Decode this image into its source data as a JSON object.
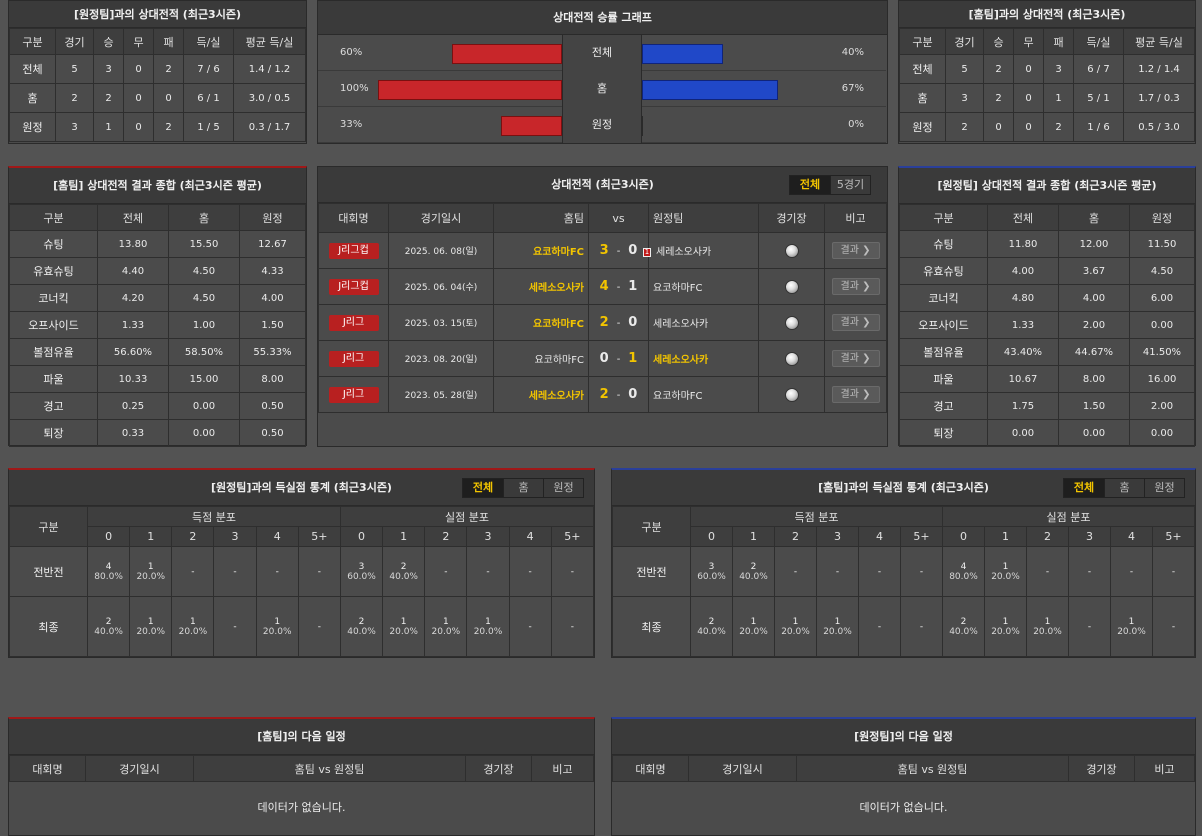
{
  "h2h_away": {
    "title": "[원정팀]과의 상대전적 (최근3시즌)",
    "headers": [
      "구분",
      "경기",
      "승",
      "무",
      "패",
      "득/실",
      "평균 득/실"
    ],
    "rows": [
      [
        "전체",
        "5",
        "3",
        "0",
        "2",
        "7 / 6",
        "1.4 / 1.2"
      ],
      [
        "홈",
        "2",
        "2",
        "0",
        "0",
        "6 / 1",
        "3.0 / 0.5"
      ],
      [
        "원정",
        "3",
        "1",
        "0",
        "2",
        "1 / 5",
        "0.3 / 1.7"
      ]
    ]
  },
  "graph": {
    "title": "상대전적 승률 그래프",
    "rows": [
      {
        "label": "전체",
        "left": "60%",
        "right": "40%",
        "left_val": 0.6,
        "right_val": 0.4
      },
      {
        "label": "홈",
        "left": "100%",
        "right": "67%",
        "left_val": 1.0,
        "right_val": 0.67
      },
      {
        "label": "원정",
        "left": "33%",
        "right": "0%",
        "left_val": 0.33,
        "right_val": 0.0
      }
    ]
  },
  "h2h_home": {
    "title": "[홈팀]과의 상대전적 (최근3시즌)",
    "headers": [
      "구분",
      "경기",
      "승",
      "무",
      "패",
      "득/실",
      "평균 득/실"
    ],
    "rows": [
      [
        "전체",
        "5",
        "2",
        "0",
        "3",
        "6 / 7",
        "1.2 / 1.4"
      ],
      [
        "홈",
        "3",
        "2",
        "0",
        "1",
        "5 / 1",
        "1.7 / 0.3"
      ],
      [
        "원정",
        "2",
        "0",
        "0",
        "2",
        "1 / 6",
        "0.5 / 3.0"
      ]
    ]
  },
  "summary_home": {
    "title": "[홈팀] 상대전적 결과 종합 (최근3시즌 평균)",
    "headers": [
      "구분",
      "전체",
      "홈",
      "원정"
    ],
    "rows": [
      [
        "슈팅",
        "13.80",
        "15.50",
        "12.67"
      ],
      [
        "유효슈팅",
        "4.40",
        "4.50",
        "4.33"
      ],
      [
        "코너킥",
        "4.20",
        "4.50",
        "4.00"
      ],
      [
        "오프사이드",
        "1.33",
        "1.00",
        "1.50"
      ],
      [
        "볼점유율",
        "56.60%",
        "58.50%",
        "55.33%"
      ],
      [
        "파울",
        "10.33",
        "15.00",
        "8.00"
      ],
      [
        "경고",
        "0.25",
        "0.00",
        "0.50"
      ],
      [
        "퇴장",
        "0.33",
        "0.00",
        "0.50"
      ]
    ]
  },
  "matches": {
    "title": "상대전적 (최근3시즌)",
    "tabs": [
      "전체",
      "5경기"
    ],
    "headers": {
      "comp": "대회명",
      "date": "경기일시",
      "home": "홈팀",
      "vs": "vs",
      "away": "원정팀",
      "venue": "경기장",
      "note": "비고"
    },
    "result_label": "결과 ❯",
    "rows": [
      {
        "comp": "J리그컵",
        "date": "2025. 06. 08(일)",
        "home": "요코하마FC",
        "hs": "3",
        "sep": "-",
        "as": "0",
        "away": "세레소오사카",
        "win": "home",
        "red": "1"
      },
      {
        "comp": "J리그컵",
        "date": "2025. 06. 04(수)",
        "home": "세레소오사카",
        "hs": "4",
        "sep": "-",
        "as": "1",
        "away": "요코하마FC",
        "win": "home",
        "red": ""
      },
      {
        "comp": "J리그",
        "date": "2025. 03. 15(토)",
        "home": "요코하마FC",
        "hs": "2",
        "sep": "-",
        "as": "0",
        "away": "세레소오사카",
        "win": "home",
        "red": ""
      },
      {
        "comp": "J리그",
        "date": "2023. 08. 20(일)",
        "home": "요코하마FC",
        "hs": "0",
        "sep": "-",
        "as": "1",
        "away": "세레소오사카",
        "win": "away",
        "red": ""
      },
      {
        "comp": "J리그",
        "date": "2023. 05. 28(일)",
        "home": "세레소오사카",
        "hs": "2",
        "sep": "-",
        "as": "0",
        "away": "요코하마FC",
        "win": "home",
        "red": ""
      }
    ]
  },
  "summary_away": {
    "title": "[원정팀] 상대전적 결과 종합 (최근3시즌 평균)",
    "headers": [
      "구분",
      "전체",
      "홈",
      "원정"
    ],
    "rows": [
      [
        "슈팅",
        "11.80",
        "12.00",
        "11.50"
      ],
      [
        "유효슈팅",
        "4.00",
        "3.67",
        "4.50"
      ],
      [
        "코너킥",
        "4.80",
        "4.00",
        "6.00"
      ],
      [
        "오프사이드",
        "1.33",
        "2.00",
        "0.00"
      ],
      [
        "볼점유율",
        "43.40%",
        "44.67%",
        "41.50%"
      ],
      [
        "파울",
        "10.67",
        "8.00",
        "16.00"
      ],
      [
        "경고",
        "1.75",
        "1.50",
        "2.00"
      ],
      [
        "퇴장",
        "0.00",
        "0.00",
        "0.00"
      ]
    ]
  },
  "goals_left": {
    "title": "[원정팀]과의 득실점 통계 (최근3시즌)",
    "tabs": [
      "전체",
      "홈",
      "원정"
    ],
    "col_label": "구분",
    "scored": "득점 분포",
    "conceded": "실점 분포",
    "buckets": [
      "0",
      "1",
      "2",
      "3",
      "4",
      "5+"
    ],
    "rows": [
      {
        "label": "전반전",
        "cells": [
          [
            "4",
            "80.0%"
          ],
          [
            "1",
            "20.0%"
          ],
          [
            "-",
            ""
          ],
          [
            "-",
            ""
          ],
          [
            "-",
            ""
          ],
          [
            "-",
            ""
          ],
          [
            "3",
            "60.0%"
          ],
          [
            "2",
            "40.0%"
          ],
          [
            "-",
            ""
          ],
          [
            "-",
            ""
          ],
          [
            "-",
            ""
          ],
          [
            "-",
            ""
          ]
        ]
      },
      {
        "label": "최종",
        "cells": [
          [
            "2",
            "40.0%"
          ],
          [
            "1",
            "20.0%"
          ],
          [
            "1",
            "20.0%"
          ],
          [
            "-",
            ""
          ],
          [
            "1",
            "20.0%"
          ],
          [
            "-",
            ""
          ],
          [
            "2",
            "40.0%"
          ],
          [
            "1",
            "20.0%"
          ],
          [
            "1",
            "20.0%"
          ],
          [
            "1",
            "20.0%"
          ],
          [
            "-",
            ""
          ],
          [
            "-",
            ""
          ]
        ]
      }
    ]
  },
  "goals_right": {
    "title": "[홈팀]과의 득실점 통계 (최근3시즌)",
    "tabs": [
      "전체",
      "홈",
      "원정"
    ],
    "col_label": "구분",
    "scored": "득점 분포",
    "conceded": "실점 분포",
    "buckets": [
      "0",
      "1",
      "2",
      "3",
      "4",
      "5+"
    ],
    "rows": [
      {
        "label": "전반전",
        "cells": [
          [
            "3",
            "60.0%"
          ],
          [
            "2",
            "40.0%"
          ],
          [
            "-",
            ""
          ],
          [
            "-",
            ""
          ],
          [
            "-",
            ""
          ],
          [
            "-",
            ""
          ],
          [
            "4",
            "80.0%"
          ],
          [
            "1",
            "20.0%"
          ],
          [
            "-",
            ""
          ],
          [
            "-",
            ""
          ],
          [
            "-",
            ""
          ],
          [
            "-",
            ""
          ]
        ]
      },
      {
        "label": "최종",
        "cells": [
          [
            "2",
            "40.0%"
          ],
          [
            "1",
            "20.0%"
          ],
          [
            "1",
            "20.0%"
          ],
          [
            "1",
            "20.0%"
          ],
          [
            "-",
            ""
          ],
          [
            "-",
            ""
          ],
          [
            "2",
            "40.0%"
          ],
          [
            "1",
            "20.0%"
          ],
          [
            "1",
            "20.0%"
          ],
          [
            "-",
            ""
          ],
          [
            "1",
            "20.0%"
          ],
          [
            "-",
            ""
          ]
        ]
      }
    ]
  },
  "next_home": {
    "title": "[홈팀]의 다음 일정",
    "headers": [
      "대회명",
      "경기일시",
      "홈팀  vs  원정팀",
      "경기장",
      "비고"
    ],
    "empty": "데이터가 없습니다."
  },
  "next_away": {
    "title": "[원정팀]의 다음 일정",
    "headers": [
      "대회명",
      "경기일시",
      "홈팀  vs  원정팀",
      "경기장",
      "비고"
    ],
    "empty": "데이터가 없습니다."
  },
  "colors": {
    "highlight": "#f2c400",
    "home_bar": "#c8262a",
    "away_bar": "#2048c8",
    "badge": "#b82020"
  },
  "icons": {
    "venue": "soccer-ball-icon",
    "red_card": "red-card-icon",
    "chevron": "chevron-right-icon"
  }
}
